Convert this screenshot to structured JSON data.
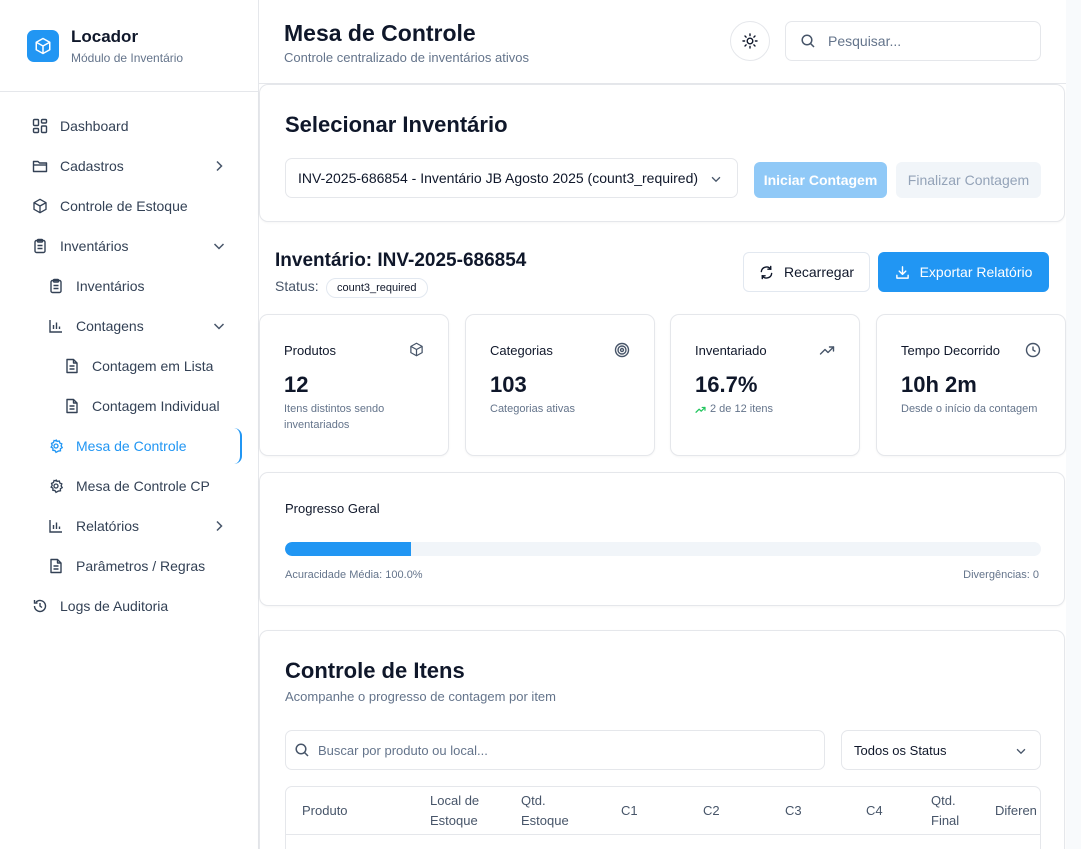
{
  "brand": {
    "title": "Locador",
    "subtitle": "Módulo de Inventário"
  },
  "sidebar": {
    "items": [
      {
        "label": "Dashboard"
      },
      {
        "label": "Cadastros"
      },
      {
        "label": "Controle de Estoque"
      },
      {
        "label": "Inventários"
      },
      {
        "label": "Inventários"
      },
      {
        "label": "Contagens"
      },
      {
        "label": "Contagem em Lista"
      },
      {
        "label": "Contagem Individual"
      },
      {
        "label": "Mesa de Controle"
      },
      {
        "label": "Mesa de Controle CP"
      },
      {
        "label": "Relatórios"
      },
      {
        "label": "Parâmetros / Regras"
      },
      {
        "label": "Logs de Auditoria"
      }
    ]
  },
  "header": {
    "title": "Mesa de Controle",
    "subtitle": "Controle centralizado de inventários ativos",
    "search_placeholder": "Pesquisar..."
  },
  "selector": {
    "title": "Selecionar Inventário",
    "selected": "INV-2025-686854 - Inventário JB Agosto 2025 (count3_required)",
    "start_label": "Iniciar Contagem",
    "finish_label": "Finalizar Contagem"
  },
  "inventory": {
    "title": "Inventário: INV-2025-686854",
    "status_label": "Status:",
    "status_value": "count3_required",
    "reload_label": "Recarregar",
    "export_label": "Exportar Relatório"
  },
  "stats": [
    {
      "label": "Produtos",
      "value": "12",
      "note": "Itens distintos sendo inventariados"
    },
    {
      "label": "Categorias",
      "value": "103",
      "note": "Categorias ativas"
    },
    {
      "label": "Inventariado",
      "value": "16.7%",
      "note": "2 de 12 itens"
    },
    {
      "label": "Tempo Decorrido",
      "value": "10h 2m",
      "note": "Desde o início da contagem"
    }
  ],
  "progress": {
    "title": "Progresso Geral",
    "percent": 16.7,
    "accuracy": "Acuracidade Média: 100.0%",
    "divergences": "Divergências: 0"
  },
  "items": {
    "title": "Controle de Itens",
    "subtitle": "Acompanhe o progresso de contagem por item",
    "search_placeholder": "Buscar por produto ou local...",
    "status_filter": "Todos os Status",
    "columns": [
      {
        "line1": "Produto",
        "line2": ""
      },
      {
        "line1": "Local de",
        "line2": "Estoque"
      },
      {
        "line1": "Qtd.",
        "line2": "Estoque"
      },
      {
        "line1": "C1",
        "line2": ""
      },
      {
        "line1": "C2",
        "line2": ""
      },
      {
        "line1": "C3",
        "line2": ""
      },
      {
        "line1": "C4",
        "line2": ""
      },
      {
        "line1": "Qtd.",
        "line2": "Final"
      },
      {
        "line1": "Diferen",
        "line2": ""
      }
    ]
  },
  "colors": {
    "accent": "#2196f3",
    "accent_disabled": "#90c9f7",
    "trend_up": "#22c55e"
  }
}
